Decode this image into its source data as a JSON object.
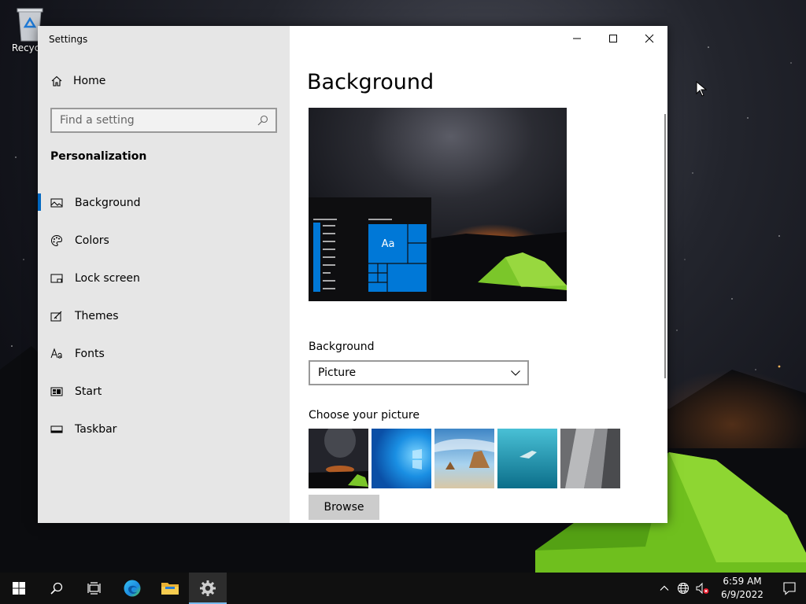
{
  "desktop": {
    "recycle_bin_label": "Recycle"
  },
  "window": {
    "app_title": "Settings",
    "caption_buttons": [
      "minimize",
      "maximize",
      "close"
    ]
  },
  "sidebar": {
    "home_label": "Home",
    "search_placeholder": "Find a setting",
    "section_title": "Personalization",
    "items": [
      {
        "label": "Background",
        "icon": "picture-icon",
        "active": true
      },
      {
        "label": "Colors",
        "icon": "palette-icon",
        "active": false
      },
      {
        "label": "Lock screen",
        "icon": "lock-screen-icon",
        "active": false
      },
      {
        "label": "Themes",
        "icon": "themes-icon",
        "active": false
      },
      {
        "label": "Fonts",
        "icon": "fonts-icon",
        "active": false
      },
      {
        "label": "Start",
        "icon": "start-icon",
        "active": false
      },
      {
        "label": "Taskbar",
        "icon": "taskbar-icon",
        "active": false
      }
    ]
  },
  "main": {
    "title": "Background",
    "preview_tile_text": "Aa",
    "background_label": "Background",
    "background_value": "Picture",
    "choose_label": "Choose your picture",
    "thumbnails": [
      "milky-way-tent",
      "windows-blue",
      "beach-rock",
      "underwater-swimmer",
      "rock-cliff"
    ],
    "browse_label": "Browse"
  },
  "taskbar": {
    "apps": [
      "start-icon",
      "search-icon",
      "task-view-icon",
      "edge-icon",
      "file-explorer-icon",
      "settings-icon"
    ],
    "active_app": "settings-icon",
    "time": "6:59 AM",
    "date": "6/9/2022"
  },
  "colors": {
    "accent": "#0067c0",
    "tile_blue": "#0078d7",
    "taskbar": "#101010",
    "sidebar": "#e6e6e6"
  }
}
